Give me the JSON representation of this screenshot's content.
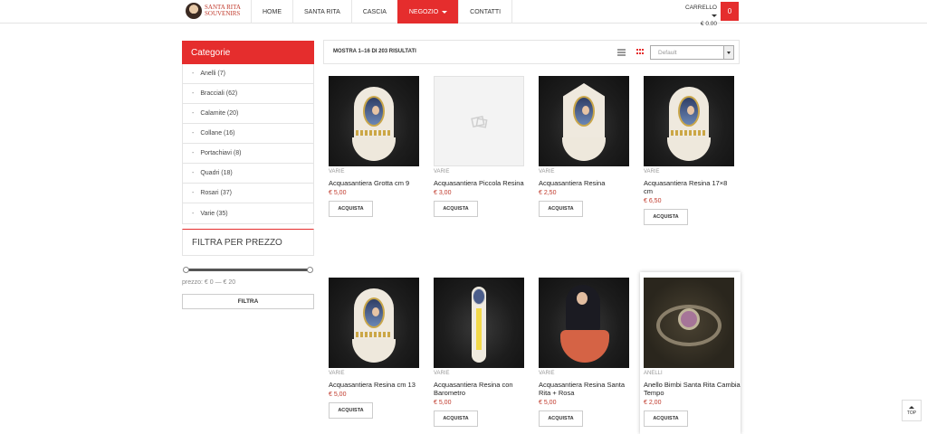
{
  "header": {
    "logo_line1": "SANTA RITA",
    "logo_line2": "SOUVENIRS",
    "nav": [
      "HOME",
      "SANTA RITA",
      "CASCIA",
      "NEGOZIO",
      "CONTATTI"
    ],
    "cart_label": "CARRELLO",
    "cart_total": "€ 0.00",
    "cart_count": "0"
  },
  "sidebar": {
    "categories_title": "Categorie",
    "categories": [
      {
        "label": "Anelli (7)"
      },
      {
        "label": "Bracciali (62)"
      },
      {
        "label": "Calamite (20)"
      },
      {
        "label": "Collane (16)"
      },
      {
        "label": "Portachiavi (8)"
      },
      {
        "label": "Quadri (18)"
      },
      {
        "label": "Rosari (37)"
      },
      {
        "label": "Varie (35)"
      }
    ],
    "filter_title": "FILTRA PER PREZZO",
    "price_range": "prezzo: € 0 — € 20",
    "filter_button": "FILTRA"
  },
  "toolbar": {
    "result_count": "MOSTRA 1–16 DI 203 RISULTATI",
    "sort_selected": "Default"
  },
  "products": [
    {
      "category": "VARIE",
      "name": "Acquasantiera Grotta cm 9",
      "price": "€ 5,00",
      "button": "ACQUISTA"
    },
    {
      "category": "VARIE",
      "name": "Acquasantiera Piccola Resina",
      "price": "€ 3,00",
      "button": "ACQUISTA"
    },
    {
      "category": "VARIE",
      "name": "Acquasantiera Resina",
      "price": "€ 2,50",
      "button": "ACQUISTA"
    },
    {
      "category": "VARIE",
      "name": "Acquasantiera Resina 17×8 cm",
      "price": "€ 6,50",
      "button": "ACQUISTA"
    },
    {
      "category": "VARIE",
      "name": "Acquasantiera Resina cm 13",
      "price": "€ 5,00",
      "button": "ACQUISTA"
    },
    {
      "category": "VARIE",
      "name": "Acquasantiera Resina con Barometro",
      "price": "€ 5,00",
      "button": "ACQUISTA"
    },
    {
      "category": "VARIE",
      "name": "Acquasantiera Resina Santa Rita + Rosa",
      "price": "€ 5,00",
      "button": "ACQUISTA"
    },
    {
      "category": "ANELLI",
      "name": "Anello Bimbi Santa Rita Cambia Tempo",
      "price": "€ 2,00",
      "button": "ACQUISTA"
    }
  ],
  "back_to_top": "TOP",
  "colors": {
    "accent": "#e52d2d",
    "price": "#c0392b"
  }
}
